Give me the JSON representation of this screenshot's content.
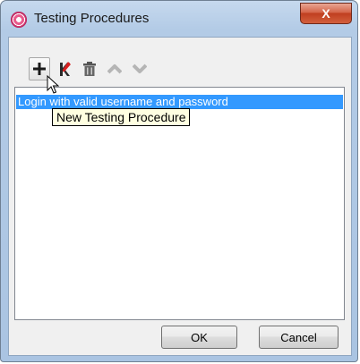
{
  "window": {
    "title": "Testing Procedures",
    "close_label": "X"
  },
  "toolbar": {
    "items": [
      {
        "name": "add-icon",
        "symbol": "+"
      },
      {
        "name": "edit-icon",
        "symbol": "✎"
      },
      {
        "name": "trash-icon",
        "symbol": "🗑"
      },
      {
        "name": "move-up-icon",
        "symbol": "⌃"
      },
      {
        "name": "move-down-icon",
        "symbol": "⌄"
      }
    ]
  },
  "list": {
    "items": [
      {
        "text": "Login with valid username and password",
        "selected": true
      }
    ]
  },
  "tooltip": {
    "text": "New Testing Procedure"
  },
  "buttons": {
    "ok_label": "OK",
    "cancel_label": "Cancel"
  },
  "colors": {
    "selection": "#3399ff",
    "tooltip_bg": "#ffffe1",
    "close_button": "#c03f20"
  }
}
